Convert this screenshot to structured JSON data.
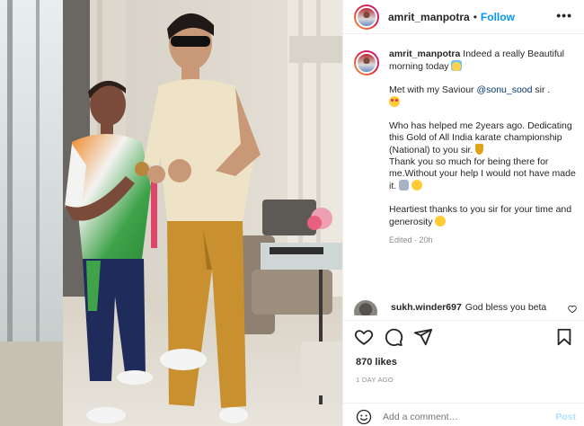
{
  "header": {
    "username": "amrit_manpotra",
    "separator": "•",
    "follow_label": "Follow",
    "more_label": "•••"
  },
  "caption": {
    "username": "amrit_manpotra",
    "line1": "Indeed a really Beautiful morning today",
    "line2_pre": "Met with my Saviour ",
    "mention": "@sonu_sood",
    "line2_post": " sir .",
    "line3": "Who has helped me 2years ago. Dedicating this Gold of All India karate championship (National) to you sir.",
    "line4": "Thank you so much for being there for me.Without your help I would not have made it.",
    "line5": "Heartiest thanks to you sir for your time and generosity",
    "edited": "Edited · 20h"
  },
  "comment": {
    "username": "sukh.winder697",
    "text": "God bless you beta"
  },
  "actions": {
    "like_icon": "heart-outline-icon",
    "comment_icon": "comment-bubble-icon",
    "share_icon": "paper-plane-icon",
    "save_icon": "bookmark-icon"
  },
  "likes": "870 likes",
  "time_ago": "1 DAY AGO",
  "add_comment": {
    "placeholder": "Add a comment…",
    "post_label": "Post",
    "emoji_icon": "smiley-icon"
  },
  "colors": {
    "follow_blue": "#0095f6",
    "muted_gray": "#8e8e8e",
    "post_disabled": "#b2dffc"
  }
}
